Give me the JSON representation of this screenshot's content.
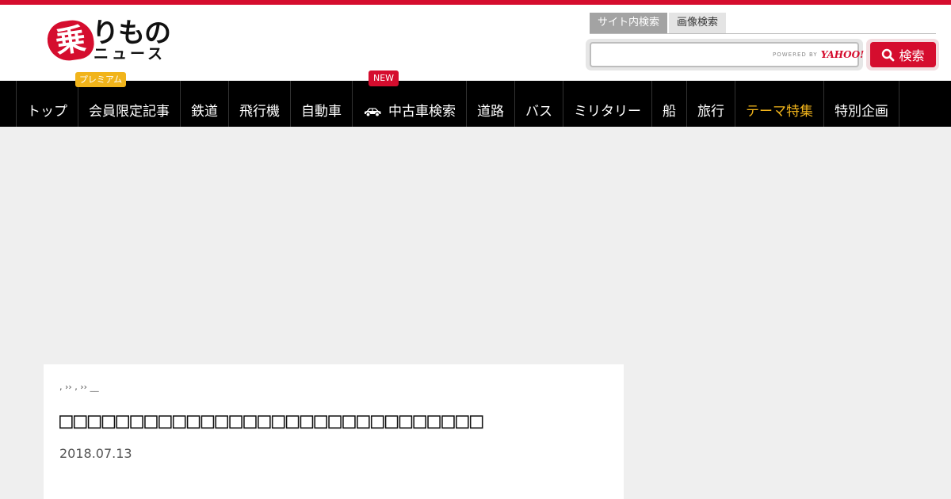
{
  "header": {
    "logo_mark": "乗",
    "logo_text_a": "りもの",
    "logo_text_b": "ニュース",
    "premium_label": "プレミアム"
  },
  "search": {
    "tabs": [
      {
        "label": "サイト内検索",
        "active": true
      },
      {
        "label": "画像検索",
        "active": false
      }
    ],
    "input_value": "",
    "powered_by": "POWERED BY",
    "provider": "YAHOO!",
    "button_label": "検索"
  },
  "nav": {
    "items": [
      {
        "label": "トップ"
      },
      {
        "label": "会員限定記事"
      },
      {
        "label": "鉄道"
      },
      {
        "label": "飛行機"
      },
      {
        "label": "自動車"
      },
      {
        "label": "中古車検索",
        "icon": "car-icon"
      },
      {
        "label": "道路"
      },
      {
        "label": "バス"
      },
      {
        "label": "ミリタリー"
      },
      {
        "label": "船"
      },
      {
        "label": "旅行"
      },
      {
        "label": "テーマ特集",
        "highlight": true
      },
      {
        "label": "特別企画"
      }
    ],
    "new_badge": "NEW"
  },
  "article": {
    "breadcrumb": ", ›› , ›› __",
    "title": "□□□□□□□□□□□□□□□□□□□□□□□□□□□□□□",
    "date": "2018.07.13"
  },
  "colors": {
    "brand_red": "#d50d2e",
    "premium_yellow": "#f1b41b",
    "nav_bg": "#000000",
    "page_bg": "#efefef"
  }
}
